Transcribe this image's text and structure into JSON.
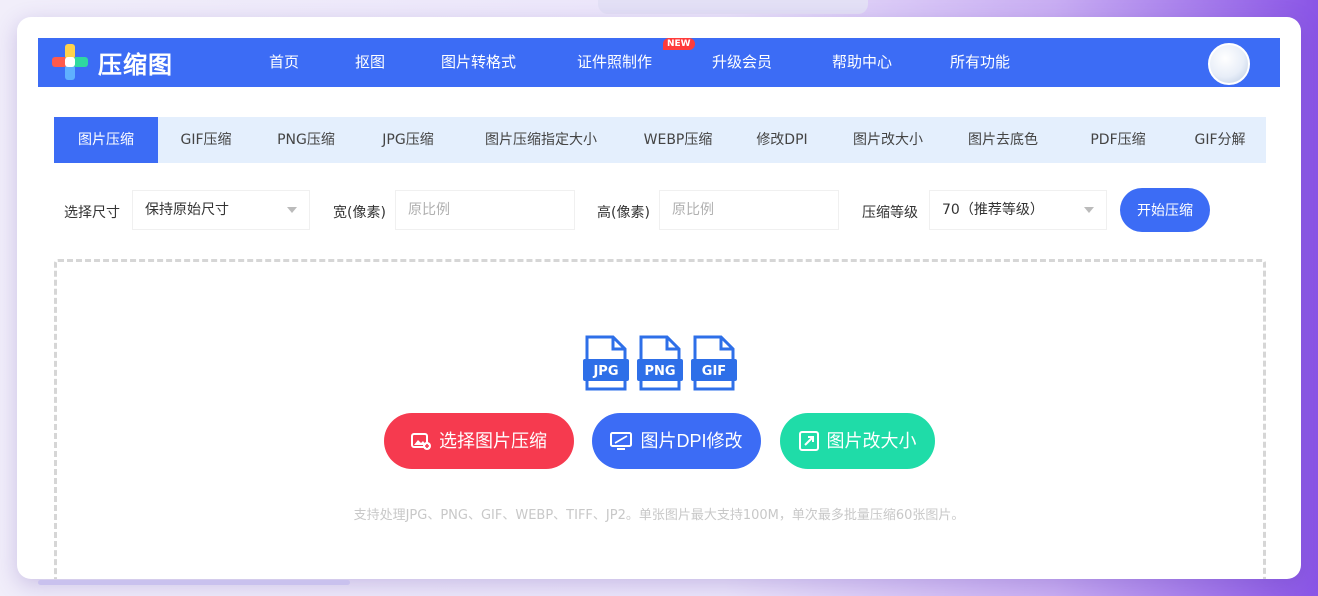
{
  "app": {
    "logo_text": "压缩图"
  },
  "nav": {
    "items": [
      "首页",
      "抠图",
      "图片转格式",
      "证件照制作",
      "升级会员",
      "帮助中心",
      "所有功能"
    ],
    "badge": "NEW"
  },
  "tabs": {
    "items": [
      "图片压缩",
      "GIF压缩",
      "PNG压缩",
      "JPG压缩",
      "图片压缩指定大小",
      "WEBP压缩",
      "修改DPI",
      "图片改大小",
      "图片去底色",
      "PDF压缩",
      "GIF分解"
    ],
    "active": "图片压缩"
  },
  "options": {
    "size_label": "选择尺寸",
    "size_value": "保持原始尺寸",
    "width_label": "宽(像素)",
    "width_placeholder": "原比例",
    "height_label": "高(像素)",
    "height_placeholder": "原比例",
    "level_label": "压缩等级",
    "level_value": "70（推荐等级）",
    "start_button": "开始压缩"
  },
  "upload": {
    "formats": [
      "JPG",
      "PNG",
      "GIF"
    ],
    "select_button": "选择图片压缩",
    "dpi_button": "图片DPI修改",
    "resize_button": "图片改大小",
    "hint": "支持处理JPG、PNG、GIF、WEBP、TIFF、JP2。单张图片最大支持100M，单次最多批量压缩60张图片。"
  },
  "colors": {
    "primary": "#3c6cf5",
    "red": "#f63a4f",
    "green": "#1fdca8",
    "tab_bg": "#e4effd"
  }
}
